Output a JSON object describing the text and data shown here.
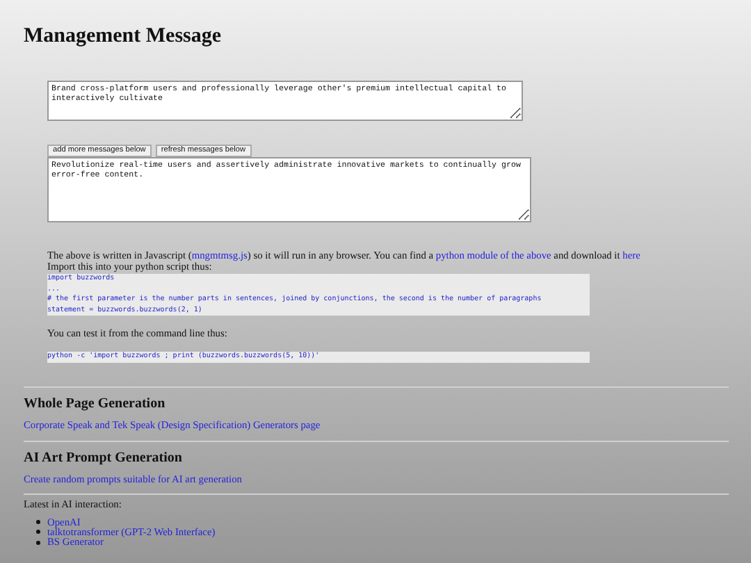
{
  "title": "Management Message",
  "message_1": "Brand cross-platform users and professionally leverage other's premium intellectual capital to interactively cultivate",
  "buttons": [
    "add more messages below",
    "refresh messages below"
  ],
  "message_2": "Revolutionize real-time users and assertively administrate innovative markets to continually grow error-free content.",
  "intro": [
    {
      "kind": "text",
      "text": "The above is written in Javascript ("
    },
    {
      "kind": "link",
      "text": "mngmtmsg.js"
    },
    {
      "kind": "text",
      "text": ") so it will run in any browser. You can find a "
    },
    {
      "kind": "link",
      "text": "python module of the above"
    },
    {
      "kind": "text",
      "text": " and download it "
    },
    {
      "kind": "link",
      "text": "here"
    }
  ],
  "import_note": "Import this into your python script thus:",
  "code_lines": [
    "import buzzwords",
    "...",
    "# the first parameter is the number parts in sentences, joined by conjunctions, the second is the number of paragraphs",
    "statement = buzzwords.buzzwords(2, 1)"
  ],
  "cli_note": "You can test it from the command line thus:",
  "cli_code": "python -c 'import buzzwords ; print (buzzwords.buzzwords(5, 10))'",
  "sections": [
    {
      "heading": "Whole Page Generation",
      "link": "Corporate Speak and Tek Speak (Design Specification) Generators page"
    },
    {
      "heading": "AI Art Prompt Generation",
      "link": "Create random prompts suitable for AI art generation"
    }
  ],
  "latest": {
    "label": "Latest in AI interaction:",
    "items": [
      "OpenAI",
      "talktotransformer (GPT-2 Web Interface)",
      "BS Generator"
    ]
  }
}
